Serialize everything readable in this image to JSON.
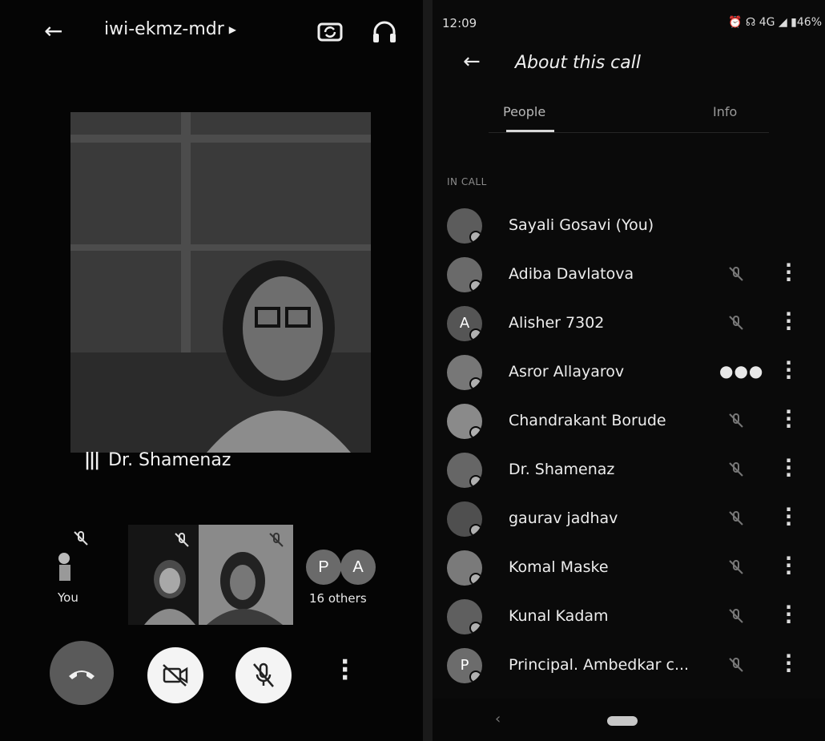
{
  "left": {
    "meeting_code": "iwi-ekmz-mdr",
    "speaker_name": "Dr. Shamenaz",
    "you_label": "You",
    "others_label": "16 others",
    "others_avatars": [
      "P",
      "A"
    ]
  },
  "right": {
    "status_time": "12:09",
    "status_battery": "46%",
    "status_network": "4G",
    "title": "About this call",
    "tabs": [
      {
        "label": "People"
      },
      {
        "label": "Info"
      }
    ],
    "section_label": "IN CALL",
    "people": [
      {
        "name": "Sayali Gosavi (You)",
        "avatar": "",
        "state": "self"
      },
      {
        "name": "Adiba Davlatova",
        "avatar": "",
        "state": "muted"
      },
      {
        "name": "Alisher 7302",
        "avatar": "A",
        "state": "muted"
      },
      {
        "name": "Asror Allayarov",
        "avatar": "",
        "state": "speaking"
      },
      {
        "name": "Chandrakant Borude",
        "avatar": "",
        "state": "muted"
      },
      {
        "name": "Dr. Shamenaz",
        "avatar": "",
        "state": "muted"
      },
      {
        "name": "gaurav jadhav",
        "avatar": "",
        "state": "muted"
      },
      {
        "name": "Komal Maske",
        "avatar": "",
        "state": "muted"
      },
      {
        "name": "Kunal Kadam",
        "avatar": "",
        "state": "muted"
      },
      {
        "name": "Principal. Ambedkar c...",
        "avatar": "P",
        "state": "muted"
      }
    ]
  }
}
